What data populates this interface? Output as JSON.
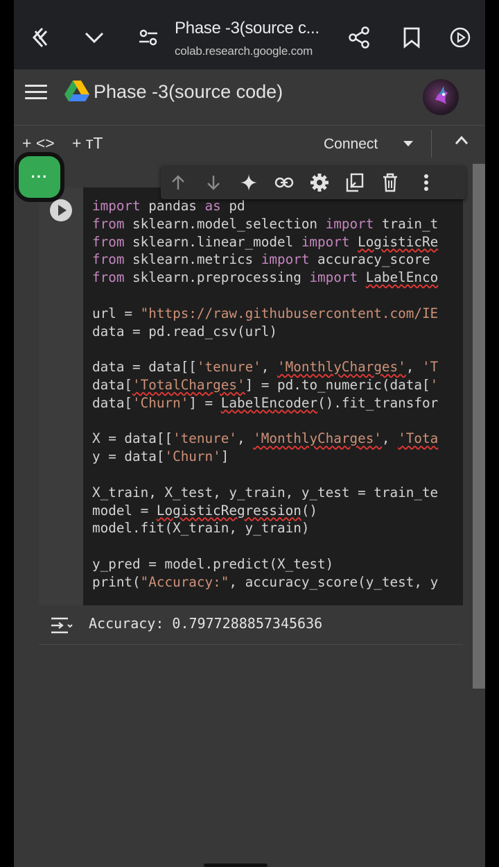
{
  "browser": {
    "title": "Phase -3(source c...",
    "url": "colab.research.google.com"
  },
  "colab": {
    "notebook_title": "Phase -3(source code)"
  },
  "toolbar": {
    "add_code": "+ <>",
    "add_text": "+ ᴛT",
    "connect": "Connect"
  },
  "floating_button": {
    "label": "···"
  },
  "cell_toolbar": {
    "icons": [
      "arrow-up-icon",
      "arrow-down-icon",
      "sparkle-icon",
      "link-icon",
      "gear-icon",
      "mirror-cell-icon",
      "trash-icon",
      "more-vert-icon"
    ]
  },
  "code_lines": [
    "import pandas as pd",
    "from sklearn.model_selection import train_t",
    "from sklearn.linear_model import LogisticRe",
    "from sklearn.metrics import accuracy_score",
    "from sklearn.preprocessing import LabelEnco",
    "",
    "url = \"https://raw.githubusercontent.com/IE",
    "data = pd.read_csv(url)",
    "",
    "data = data[['tenure', 'MonthlyCharges', 'T",
    "data['TotalCharges'] = pd.to_numeric(data['",
    "data['Churn'] = LabelEncoder().fit_transfor",
    "",
    "X = data[['tenure', 'MonthlyCharges', 'Tota",
    "y = data['Churn']",
    "",
    "X_train, X_test, y_train, y_test = train_te",
    "model = LogisticRegression()",
    "model.fit(X_train, y_train)",
    "",
    "y_pred = model.predict(X_test)",
    "print(\"Accuracy:\", accuracy_score(y_test, y"
  ],
  "output": {
    "text": "Accuracy: 0.7977288857345636"
  },
  "colors": {
    "keyword": "#c586c0",
    "string": "#ce9178",
    "green": "#34a853",
    "background": "#383838"
  }
}
